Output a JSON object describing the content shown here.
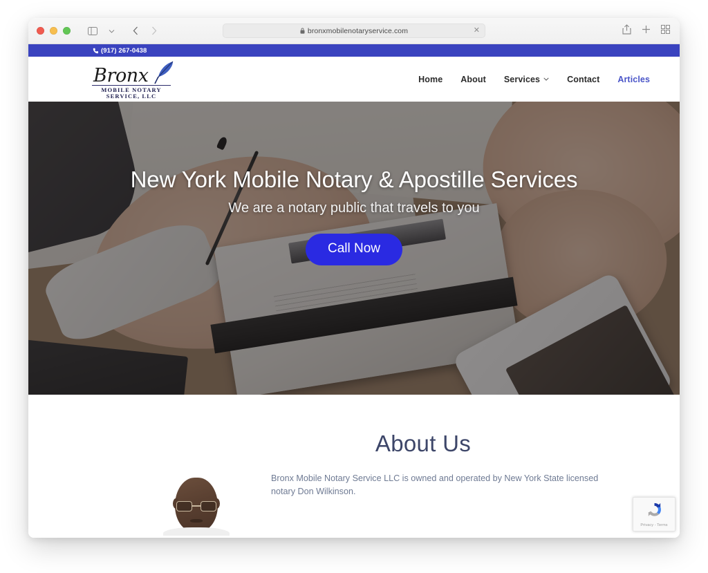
{
  "browser": {
    "url": "bronxmobilenotaryservice.com",
    "lock_icon": "lock-icon",
    "close_tab_icon": "close-icon",
    "sidebar_icon": "sidebar-icon",
    "chevron_down_icon": "chevron-down-icon",
    "back_icon": "back-arrow-icon",
    "forward_icon": "forward-arrow-icon",
    "reader_icon": "reader-mode-icon",
    "share_icon": "share-icon",
    "new_tab_icon": "plus-icon",
    "tab_overview_icon": "tab-overview-icon"
  },
  "topbar": {
    "phone": "(917) 267-0438",
    "phone_icon": "phone-icon",
    "bg_color": "#3a43bf"
  },
  "logo": {
    "brand": "Bronx",
    "line1": "MOBILE NOTARY",
    "line2": "SERVICE, LLC",
    "quill_icon": "quill-feather-icon"
  },
  "nav": {
    "items": [
      {
        "label": "Home",
        "active": false,
        "has_caret": false
      },
      {
        "label": "About",
        "active": false,
        "has_caret": false
      },
      {
        "label": "Services",
        "active": false,
        "has_caret": true
      },
      {
        "label": "Contact",
        "active": false,
        "has_caret": false
      },
      {
        "label": "Articles",
        "active": true,
        "has_caret": false
      }
    ],
    "caret_glyph": "⌄",
    "active_color": "#4a55c8"
  },
  "hero": {
    "title": "New York Mobile Notary & Apostille Services",
    "subtitle": "We are a notary public that travels to you",
    "cta_label": "Call Now",
    "cta_color": "#2a2ae2",
    "image_description": "Person signing a document on a clipboard at a wooden desk with a pen and a white smartphone"
  },
  "about": {
    "title": "About Us",
    "title_color": "#3d4669",
    "body": "Bronx Mobile Notary Service LLC is owned and operated by New York State licensed notary Don Wilkinson.",
    "portrait_alt": "Portrait of Don Wilkinson wearing glasses"
  },
  "recaptcha": {
    "label": "Privacy - Terms",
    "icon": "recaptcha-icon"
  }
}
